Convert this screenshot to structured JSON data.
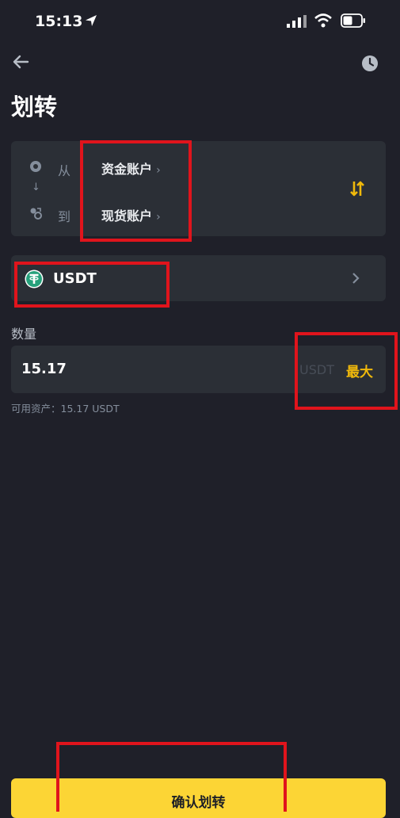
{
  "status_bar": {
    "time": "15:13",
    "icons": [
      "location-arrow-icon",
      "signal-icon",
      "wifi-icon",
      "battery-icon"
    ]
  },
  "header": {
    "title": "划转",
    "back_icon": "arrow-left-icon",
    "history_icon": "clock-icon"
  },
  "transfer": {
    "from_label": "从",
    "from_account": "资金账户",
    "down_arrow": "↓",
    "to_label": "到",
    "to_account": "现货账户",
    "chevron": "›",
    "swap_icon": "swap-icon"
  },
  "coin": {
    "name": "USDT",
    "icon": "tether-icon"
  },
  "amount": {
    "label": "数量",
    "value": "15.17",
    "unit": "USDT",
    "max_label": "最大",
    "available_text": "可用资产：15.17 USDT"
  },
  "confirm_button": {
    "label": "确认划转"
  },
  "colors": {
    "background": "#1f2029",
    "card": "#2b2f36",
    "accent": "#f0b90b",
    "button": "#fcd535",
    "highlight": "#e0141c"
  }
}
